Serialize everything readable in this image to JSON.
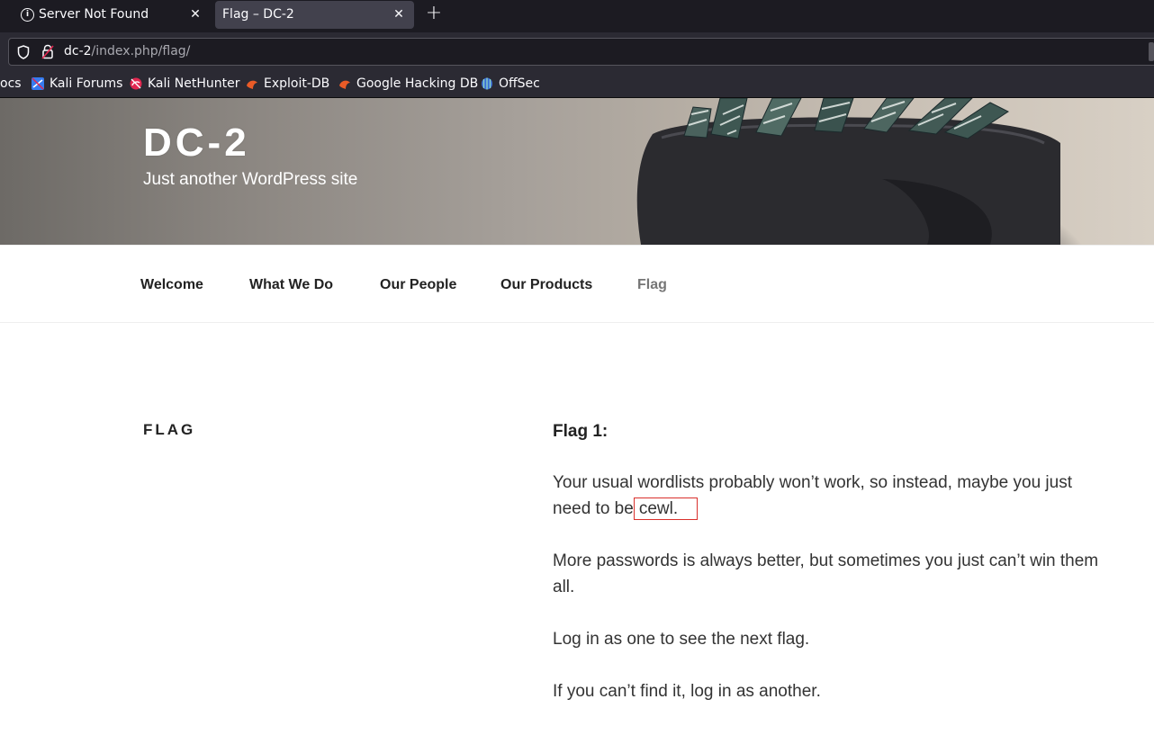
{
  "browser": {
    "tabs": [
      {
        "label": "Server Not Found",
        "icon": "info-icon",
        "active": false
      },
      {
        "label": "Flag – DC-2",
        "icon": "",
        "active": true
      }
    ],
    "url_host": "dc-2",
    "url_path": "/index.php/flag/",
    "bookmarks": [
      {
        "label": "ocs",
        "icon": ""
      },
      {
        "label": "Kali Forums",
        "icon": "kali-forums-icon"
      },
      {
        "label": "Kali NetHunter",
        "icon": "kali-nethunter-icon"
      },
      {
        "label": "Exploit-DB",
        "icon": "exploit-db-icon"
      },
      {
        "label": "Google Hacking DB",
        "icon": "ghdb-icon"
      },
      {
        "label": "OffSec",
        "icon": "offsec-icon"
      }
    ]
  },
  "site": {
    "title": "DC-2",
    "description": "Just another WordPress site"
  },
  "nav": {
    "items": [
      {
        "label": "Welcome",
        "current": false
      },
      {
        "label": "What We Do",
        "current": false
      },
      {
        "label": "Our People",
        "current": false
      },
      {
        "label": "Our Products",
        "current": false
      },
      {
        "label": "Flag",
        "current": true
      }
    ]
  },
  "page": {
    "title": "FLAG",
    "flag_heading": "Flag 1:",
    "p1_before": "Your usual wordlists probably won’t work, so instead, maybe you just need to be",
    "p1_highlight": "cewl.",
    "p2": "More passwords is always better, but sometimes you just can’t win them all.",
    "p3": "Log in as one to see the next flag.",
    "p4": "If you can’t find it, log in as another."
  },
  "colors": {
    "tabbar": "#1c1b22",
    "toolbar": "#2b2a33",
    "highlight_box": "#d9302c"
  }
}
